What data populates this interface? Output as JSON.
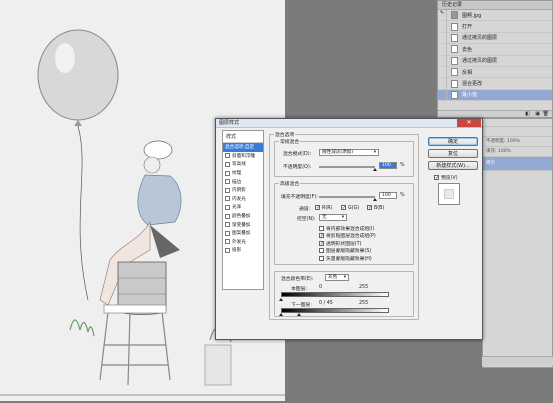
{
  "history": {
    "title": "历史记录",
    "snapshot": "图啊.jpg",
    "items": [
      "打开",
      "通过拷贝的图层",
      "去色",
      "通过拷贝的图层",
      "反相",
      "混合更改",
      "最小值"
    ],
    "selected_index": 6
  },
  "layers": {
    "opacity_label": "不透明度:",
    "fill_label": "填充:",
    "pct": "100%",
    "layer_name": "拷贝"
  },
  "dialog": {
    "title": "图层样式",
    "close": "✕",
    "styles_header": "样式",
    "styles": [
      {
        "label": "混合选项:自定",
        "checked": null,
        "selected": true
      },
      {
        "label": "斜面和浮雕",
        "checked": false
      },
      {
        "label": "等高线",
        "checked": false
      },
      {
        "label": "纹理",
        "checked": false
      },
      {
        "label": "描边",
        "checked": false
      },
      {
        "label": "内阴影",
        "checked": false
      },
      {
        "label": "内发光",
        "checked": false
      },
      {
        "label": "光泽",
        "checked": false
      },
      {
        "label": "颜色叠加",
        "checked": false
      },
      {
        "label": "渐变叠加",
        "checked": false
      },
      {
        "label": "图案叠加",
        "checked": false
      },
      {
        "label": "外发光",
        "checked": false
      },
      {
        "label": "投影",
        "checked": false
      }
    ],
    "blend_options": "混合选项",
    "general": {
      "title": "常规混合",
      "mode_label": "混合模式(D):",
      "mode_value": "线性减淡(添加)",
      "opacity_label": "不透明度(O):",
      "opacity_value": "100",
      "pct": "%"
    },
    "advanced": {
      "title": "高级混合",
      "fill_label": "填充不透明度(F):",
      "fill_value": "100",
      "pct": "%",
      "channels_label": "通道:",
      "channels": [
        "R(R)",
        "G(G)",
        "B(B)"
      ],
      "knockout_label": "挖空(N):",
      "knockout_value": "无",
      "options": [
        {
          "label": "将内部效果混合成组(I)",
          "checked": false
        },
        {
          "label": "将剪贴图层混合成组(P)",
          "checked": true
        },
        {
          "label": "透明形状图层(T)",
          "checked": true
        },
        {
          "label": "图层蒙版隐藏效果(S)",
          "checked": false
        },
        {
          "label": "矢量蒙版隐藏效果(H)",
          "checked": false
        }
      ]
    },
    "blend_if": {
      "label": "混合颜色带(E):",
      "value": "灰色",
      "this_layer": "本图层:",
      "this_min": "0",
      "this_max": "255",
      "below_layer": "下一图层:",
      "below_min": "0 / 45",
      "below_max": "255"
    },
    "buttons": {
      "ok": "确定",
      "reset": "复位",
      "new_style": "新建样式(W)...",
      "preview": "预览(V)"
    }
  }
}
